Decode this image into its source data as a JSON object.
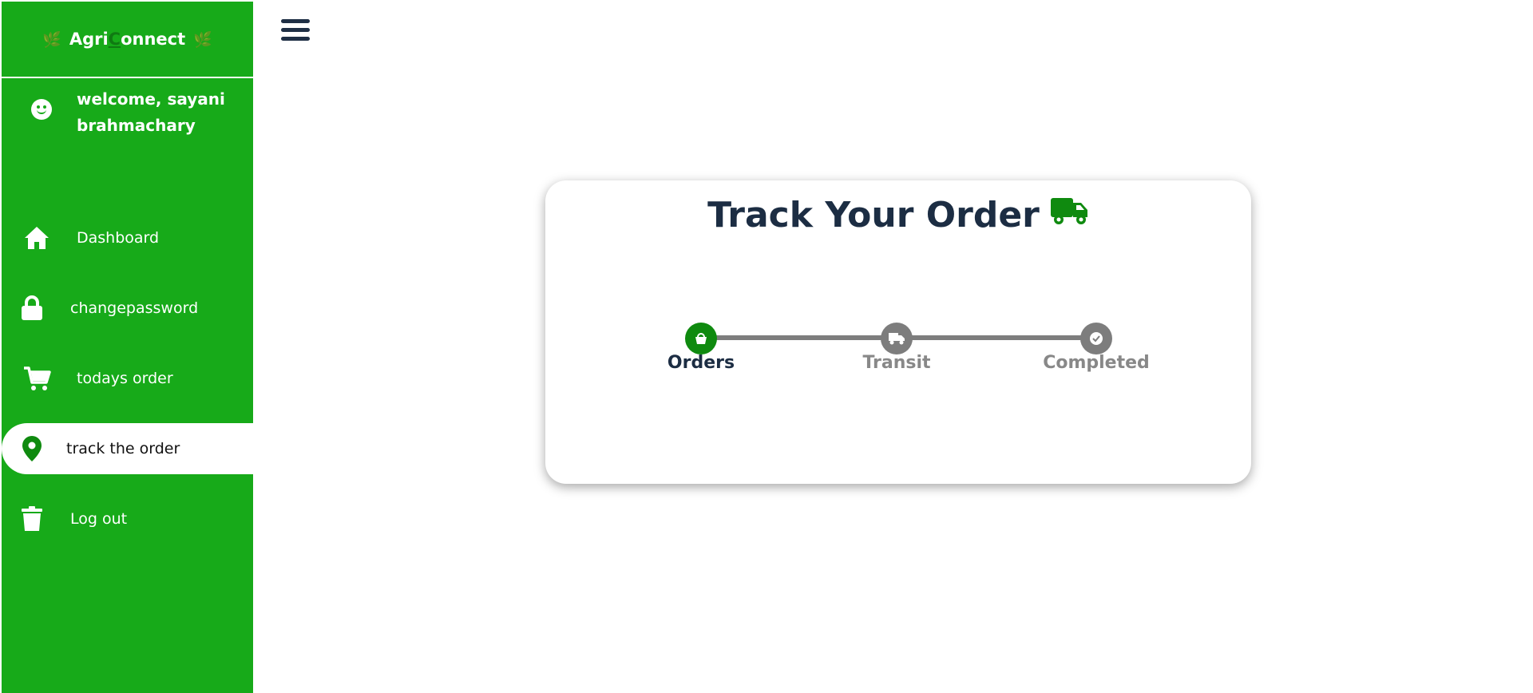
{
  "brand": {
    "name_prefix": "Agri",
    "name_o": "C",
    "name_suffix": "onnect",
    "leaf_icon": "🌿"
  },
  "user": {
    "welcome": "welcome, sayani brahmachary"
  },
  "menu": [
    {
      "label": "Dashboard",
      "icon": "home-icon"
    },
    {
      "label": "changepassword",
      "icon": "lock-icon"
    },
    {
      "label": "todays order",
      "icon": "cart-icon"
    },
    {
      "label": "track the order",
      "icon": "map-pin-icon",
      "active": true
    },
    {
      "label": "Log out",
      "icon": "trash-icon"
    }
  ],
  "tracker": {
    "title": "Track Your Order",
    "steps": [
      {
        "label": "Orders",
        "icon": "shopping-basket-icon",
        "status": "done"
      },
      {
        "label": "Transit",
        "icon": "truck-icon",
        "status": "pending"
      },
      {
        "label": "Completed",
        "icon": "check-circle-icon",
        "status": "pending"
      }
    ]
  },
  "colors": {
    "sidebar": "#17aa19",
    "accent_green": "#0f8a0f",
    "heading": "#1c2d43",
    "inactive_step": "#7d7d7d"
  }
}
